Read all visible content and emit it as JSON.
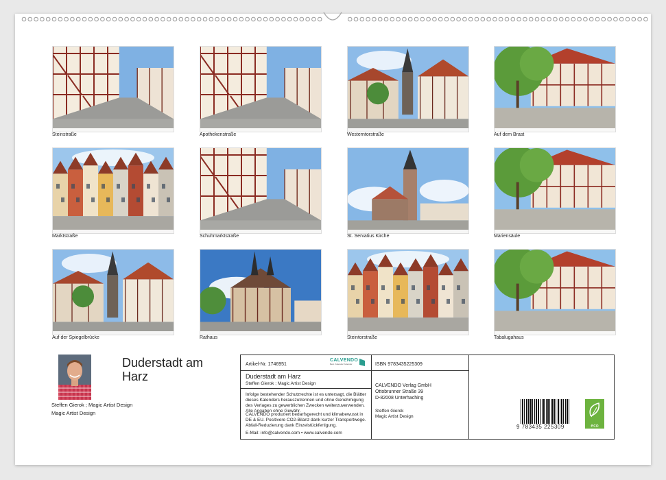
{
  "photos": [
    {
      "caption": "Steinstraße",
      "scene": "street"
    },
    {
      "caption": "Apothekenstraße",
      "scene": "street"
    },
    {
      "caption": "Westerntorstraße",
      "scene": "tower"
    },
    {
      "caption": "Auf dem Brast",
      "scene": "trees"
    },
    {
      "caption": "Marktstraße",
      "scene": "row"
    },
    {
      "caption": "Schuhmarktstraße",
      "scene": "street"
    },
    {
      "caption": "St. Servatius Kirche",
      "scene": "church"
    },
    {
      "caption": "Mariensäule",
      "scene": "trees"
    },
    {
      "caption": "Auf der Spiegelbrücke",
      "scene": "tower"
    },
    {
      "caption": "Rathaus",
      "scene": "hall"
    },
    {
      "caption": "Steintorstraße",
      "scene": "row"
    },
    {
      "caption": "Tabalugahaus",
      "scene": "trees"
    }
  ],
  "title": "Duderstadt am Harz",
  "author": {
    "line1": "Steffen Gierok ; Magic Artist Design",
    "line2": "Magic Artist Design"
  },
  "info": {
    "article": "Artikel-Nr. 1746951",
    "brand": "CALVENDO",
    "brand_sub": "Best. Kalender Kalender",
    "title": "Duderstadt am Harz",
    "author": "Steffen Gierok ; Magic Artist Design",
    "notice1": "Infolge bestehender Schutzrechte ist es untersagt, die Blätter dieses Kalenders herauszutrennen und ohne Genehmigung des Verlages zu gewerblichen Zwecken weiterzuverwenden. Alle Angaben ohne Gewähr.",
    "notice2": "CALVENDO produziert bedarfsgerecht und klimabewusst in DE & EU. Positivere CO2-Bilanz dank kurzer Transportwege. Abfall-Reduzierung dank Einzelstückfertigung.",
    "contact": "E-Mail: info@calvendo.com • www.calvendo.com",
    "isbn": "ISBN 9783435225309",
    "publisher": [
      "CALVENDO Verlag GmbH",
      "Ottobrunner Straße 39",
      "D-82008 Unterhaching"
    ],
    "publisher_author": [
      "Steffen Gierok",
      "Magic Artist Design"
    ],
    "barcode_digits": "9 783435 225309",
    "eco_label": "eco"
  }
}
